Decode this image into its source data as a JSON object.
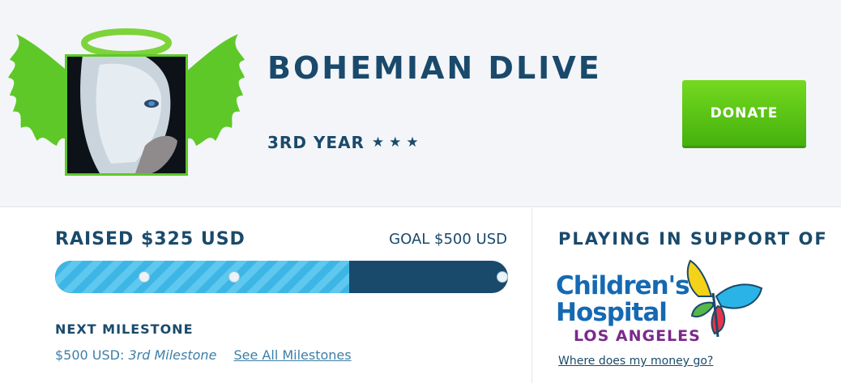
{
  "header": {
    "streamer_name": "BOHEMIAN DLIVE",
    "year_label": "3RD YEAR",
    "stars": [
      "★",
      "★",
      "★"
    ],
    "donate_label": "DONATE"
  },
  "progress": {
    "raised_label": "RAISED $325 USD",
    "goal_label": "GOAL $500 USD",
    "raised_amount": 325,
    "goal_amount": 500,
    "fraction": 0.65
  },
  "milestone": {
    "title": "NEXT MILESTONE",
    "amount": "$500 USD:",
    "name": "3rd Milestone",
    "see_all_label": "See All Milestones"
  },
  "support": {
    "title": "PLAYING IN SUPPORT OF",
    "charity_line1": "Children's",
    "charity_line2": "Hospital",
    "charity_line3": "LOS ANGELES",
    "money_link": "Where does my money go?"
  },
  "colors": {
    "navy": "#1a4a6b",
    "accent_green": "#5ec828",
    "progress_blue": "#3db6e6",
    "link_blue": "#3d7fa8",
    "charity_blue": "#1569b3",
    "charity_purple": "#7a2a8c"
  },
  "icons": {
    "avatar_frame": "angel-wings-halo-icon",
    "star": "star-icon",
    "charity_logo": "butterfly-icon"
  }
}
